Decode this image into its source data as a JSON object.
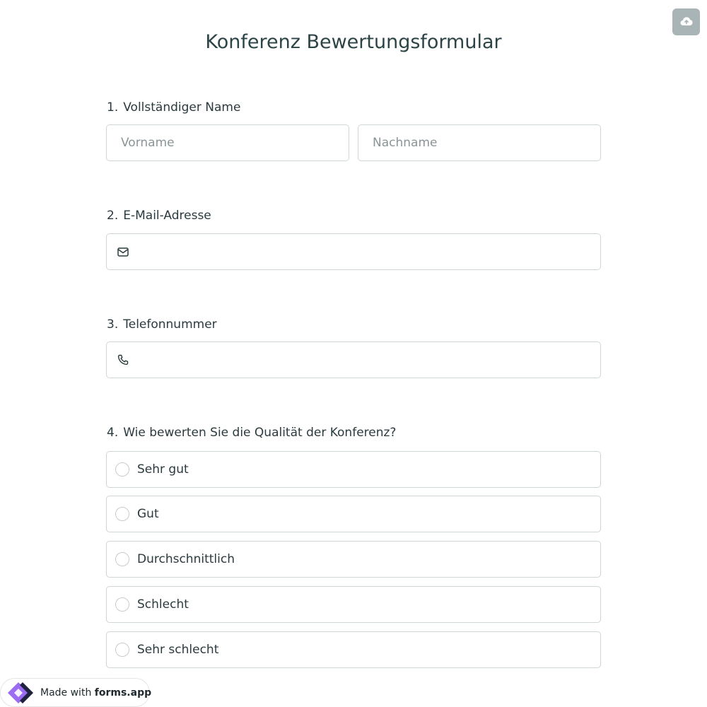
{
  "form": {
    "title": "Konferenz Bewertungsformular",
    "questions": [
      {
        "number": "1.",
        "label": "Vollständiger Name"
      },
      {
        "number": "2.",
        "label": "E-Mail-Adresse"
      },
      {
        "number": "3.",
        "label": "Telefonnummer"
      },
      {
        "number": "4.",
        "label": "Wie bewerten Sie die Qualität der Konferenz?"
      }
    ],
    "name": {
      "first_placeholder": "Vorname",
      "last_placeholder": "Nachname",
      "first_value": "",
      "last_value": ""
    },
    "email": {
      "value": "",
      "icon": "envelope-icon"
    },
    "phone": {
      "value": "",
      "icon": "phone-icon"
    },
    "rating_options": [
      "Sehr gut",
      "Gut",
      "Durchschnittlich",
      "Schlecht",
      "Sehr schlecht"
    ]
  },
  "toolbar": {
    "save_icon": "cloud-upload-icon"
  },
  "badge": {
    "prefix": "Made with",
    "brand": "forms.app"
  },
  "colors": {
    "title": "#2d4447",
    "text": "#2b3a3f",
    "border": "#cfd6d8",
    "placeholder": "#8a9597",
    "save_button_bg": "#a9b4b6",
    "brand_purple": "#9b6bf2",
    "brand_dark": "#1e2140"
  }
}
